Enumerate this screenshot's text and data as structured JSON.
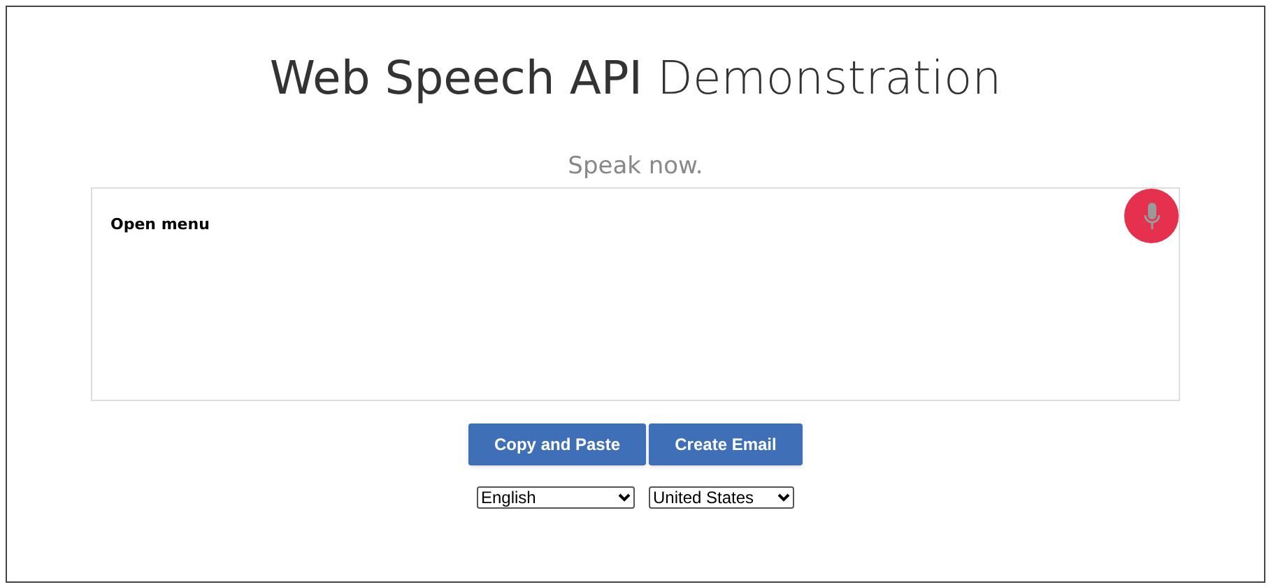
{
  "title": "**Web Speech API** Demonstration",
  "status": "Speak now.",
  "transcript": {
    "text": "Open menu"
  },
  "buttons": [
    "Copy and Paste",
    "Create Email"
  ],
  "language": {
    "value": "English"
  },
  "dialect": {
    "value": "United States"
  }
}
